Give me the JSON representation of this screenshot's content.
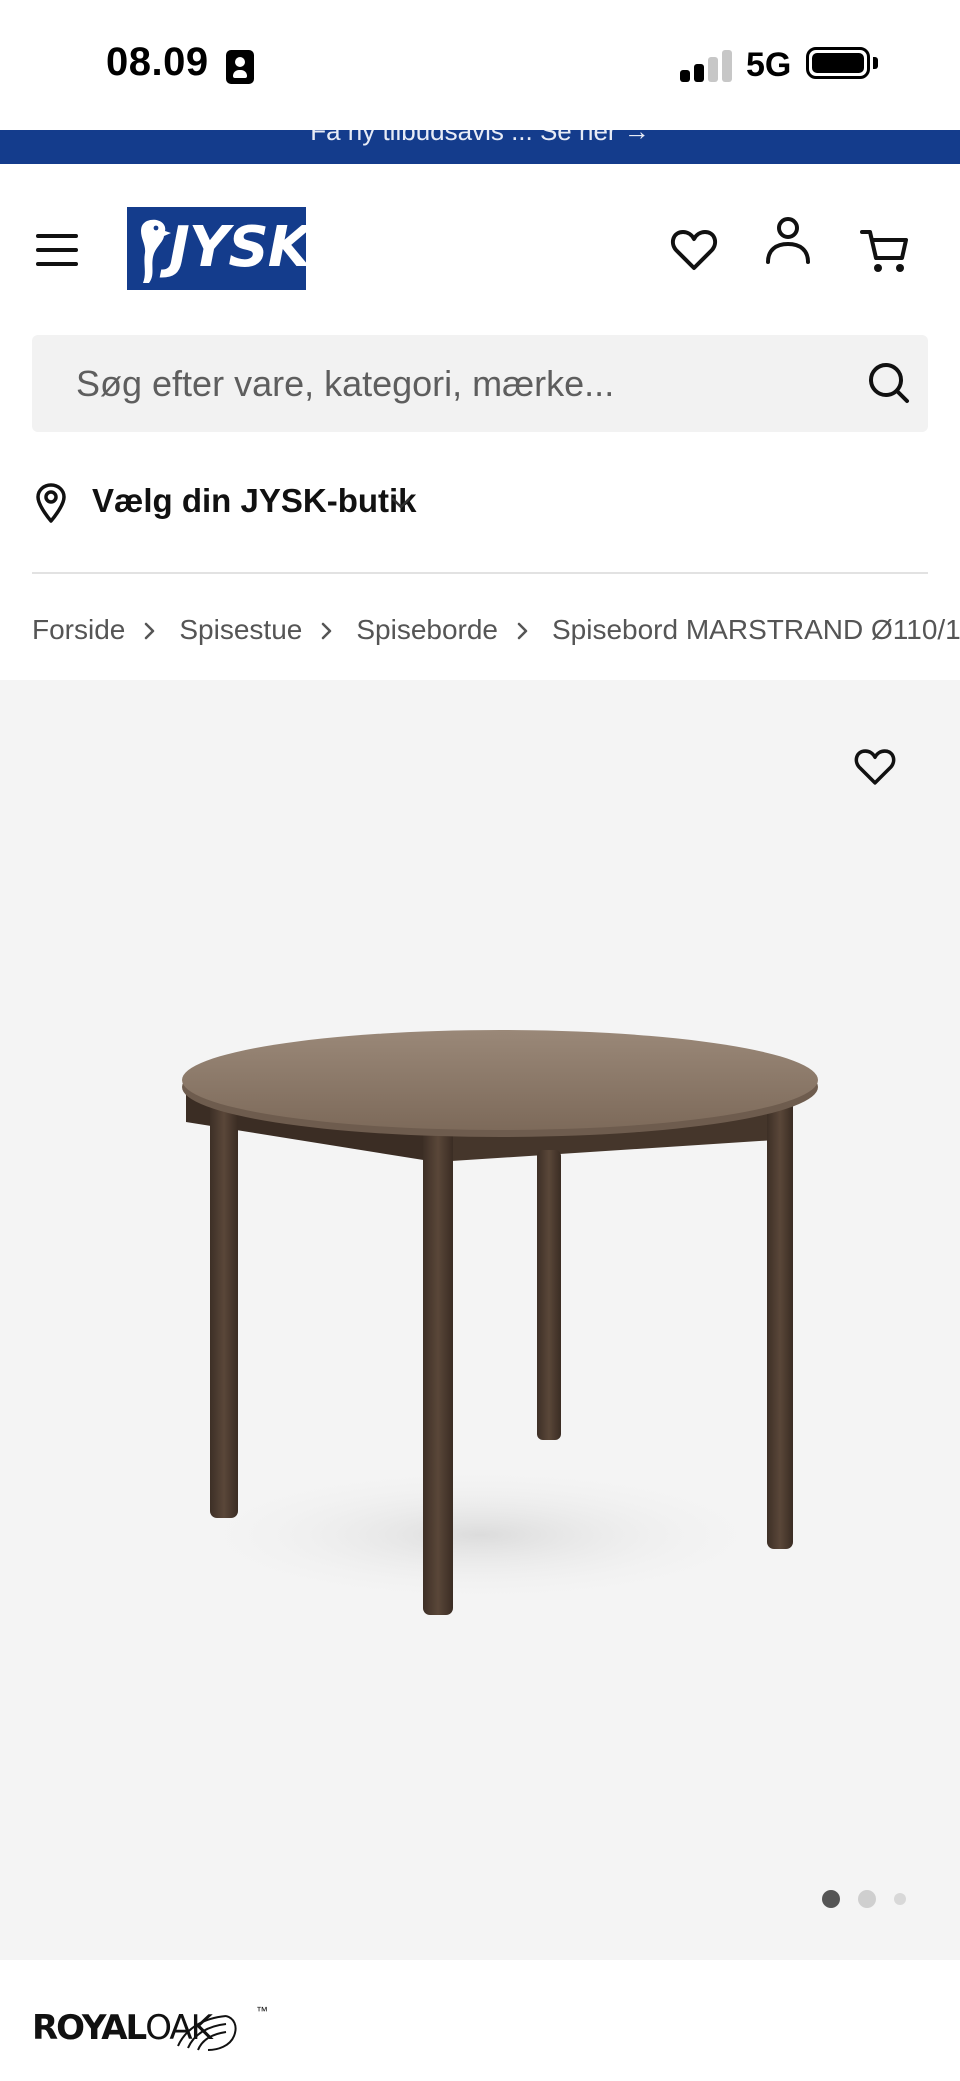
{
  "status_bar": {
    "time": "08.09",
    "network": "5G",
    "signal_bars_active": 2,
    "signal_bars_total": 4,
    "battery_level": 1.0
  },
  "promo_banner": {
    "text": "Få ny tilbudsavis ... Se her →"
  },
  "header": {
    "logo_text": "JYSK",
    "icons": [
      "menu-icon",
      "heart-icon",
      "user-icon",
      "cart-icon"
    ]
  },
  "search": {
    "placeholder": "Søg efter vare, kategori, mærke..."
  },
  "store_selector": {
    "label": "Vælg din JYSK-butik"
  },
  "breadcrumb": {
    "items": [
      "Forside",
      "Spisestue",
      "Spiseborde",
      "Spisebord MARSTRAND Ø110/1"
    ]
  },
  "gallery": {
    "active_image_index": 0,
    "image_count": 3
  },
  "brand": {
    "name_bold": "ROYAL",
    "name_light": "OAK",
    "trademark": "™"
  },
  "colors": {
    "brand_blue": "#143c8c",
    "gallery_bg": "#f4f4f4",
    "table_top": "#8a7766",
    "table_legs": "#4a3a30"
  }
}
